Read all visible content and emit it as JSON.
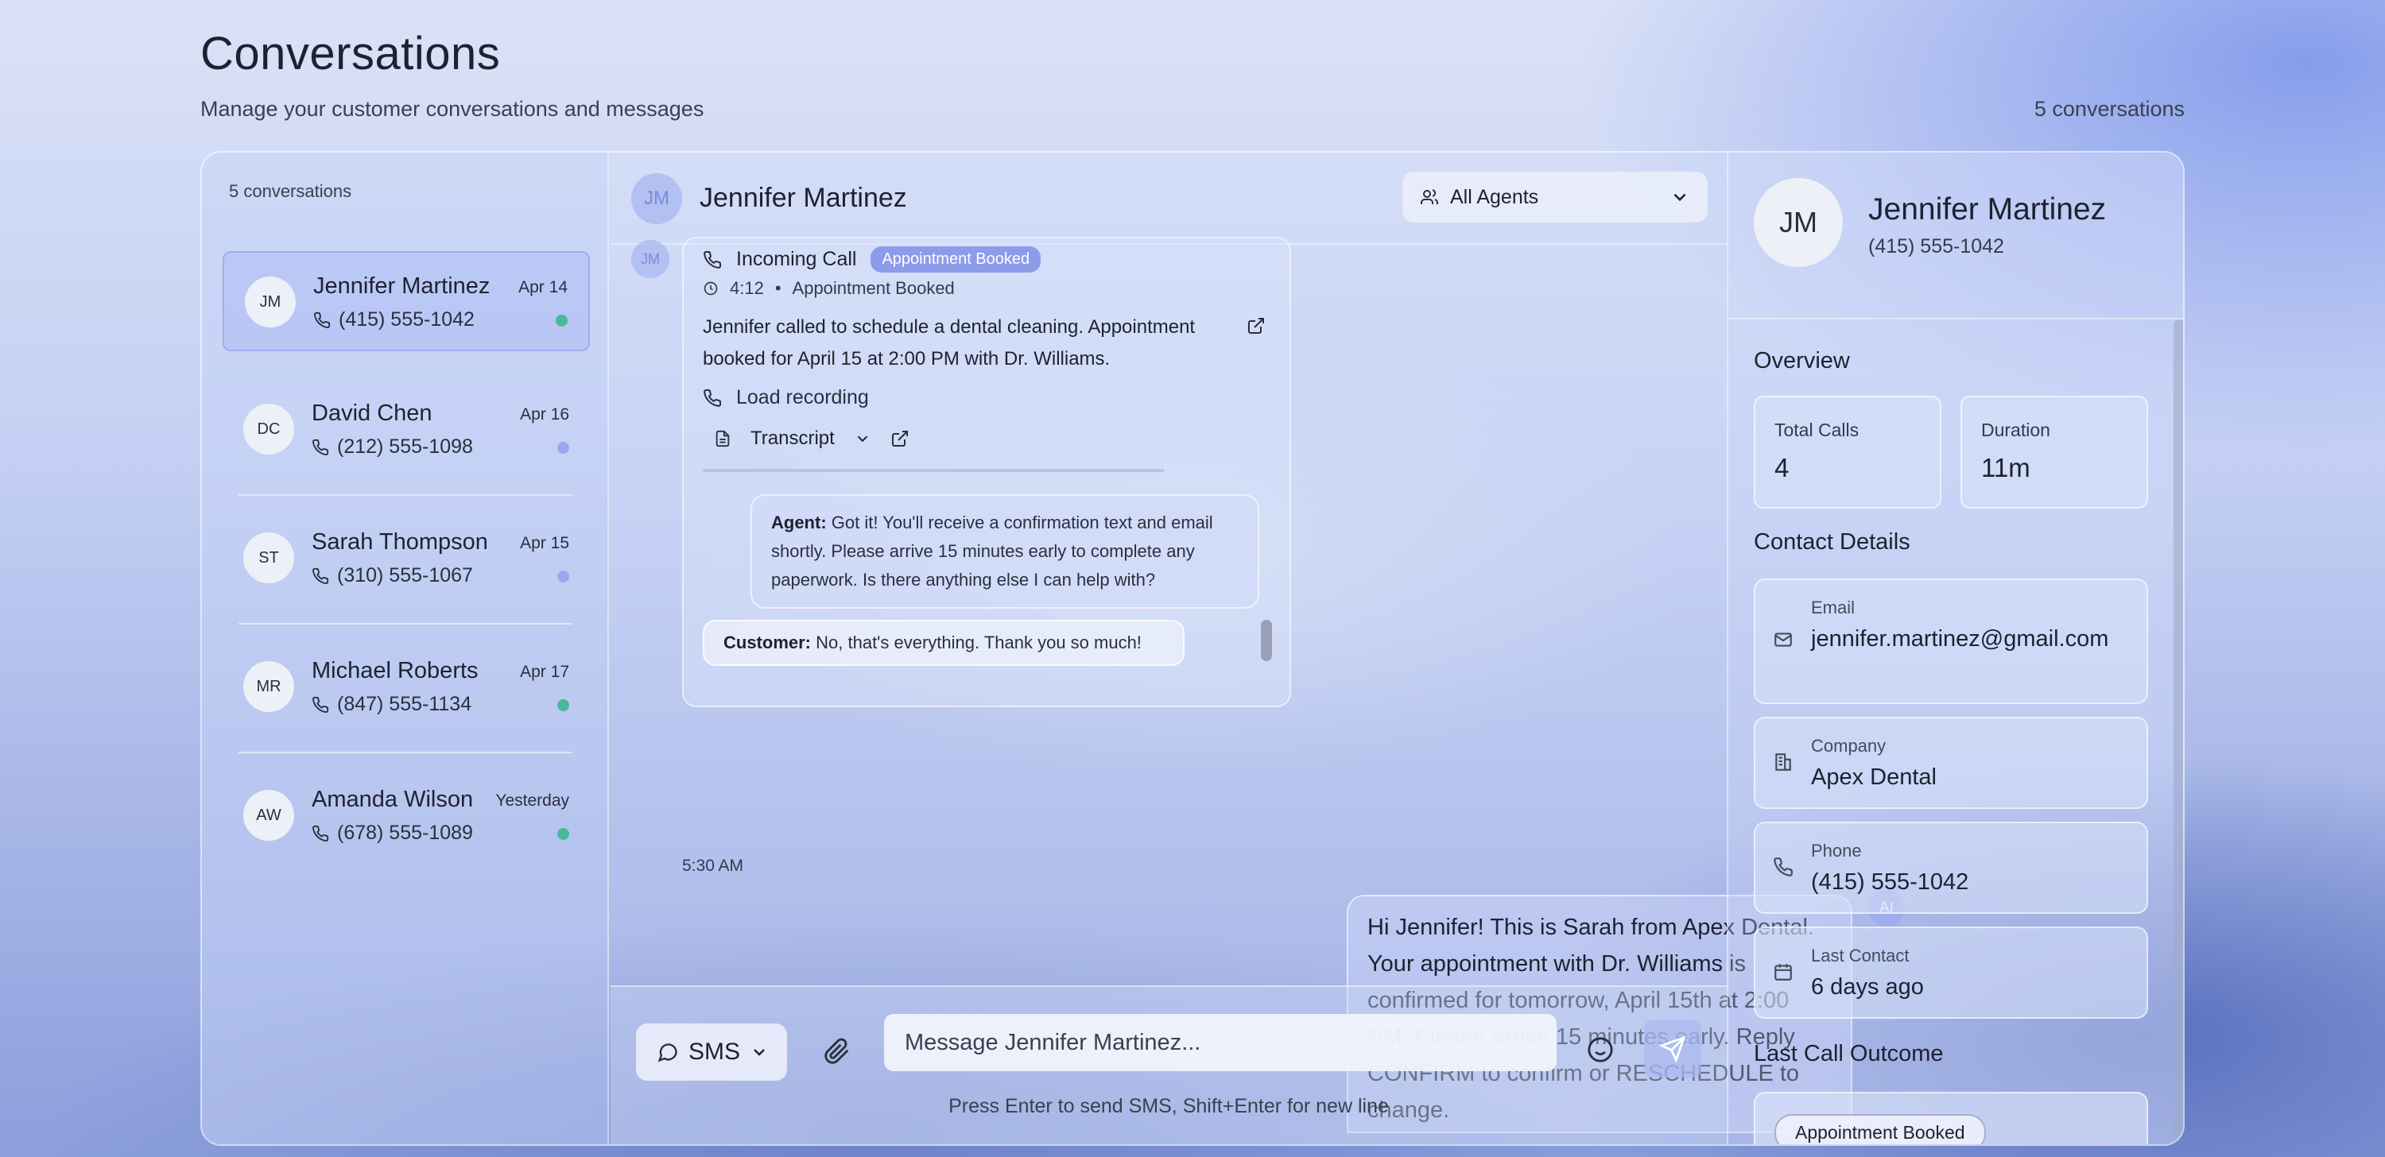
{
  "page": {
    "title": "Conversations",
    "subtitle": "Manage your customer conversations and messages",
    "count_label": "5 conversations"
  },
  "sidebar": {
    "count_label": "5 conversations",
    "conversations": [
      {
        "initials": "JM",
        "name": "Jennifer Martinez",
        "phone": "(415) 555-1042",
        "date": "Apr 14",
        "status_color": "#4bb89a"
      },
      {
        "initials": "DC",
        "name": "David Chen",
        "phone": "(212) 555-1098",
        "date": "Apr 16",
        "status_color": "#9aa8f0"
      },
      {
        "initials": "ST",
        "name": "Sarah Thompson",
        "phone": "(310) 555-1067",
        "date": "Apr 15",
        "status_color": "#9aa8f0"
      },
      {
        "initials": "MR",
        "name": "Michael Roberts",
        "phone": "(847) 555-1134",
        "date": "Apr 17",
        "status_color": "#4bb89a"
      },
      {
        "initials": "AW",
        "name": "Amanda Wilson",
        "phone": "(678) 555-1089",
        "date": "Yesterday",
        "status_color": "#4bb89a"
      }
    ]
  },
  "chat": {
    "header": {
      "initials": "JM",
      "name": "Jennifer Martinez",
      "agent_filter": "All Agents"
    },
    "call_card": {
      "avatar_initials": "JM",
      "title": "Incoming Call",
      "tag": "Appointment Booked",
      "duration": "4:12",
      "outcome": "Appointment Booked",
      "summary": "Jennifer called to schedule a dental cleaning. Appointment booked for April 15 at 2:00 PM with Dr. Williams.",
      "recording_label": "Load recording",
      "transcript_label": "Transcript",
      "agent_label": "Agent:",
      "agent_text": "Got it! You'll receive a confirmation text and email shortly. Please arrive 15 minutes early to complete any paperwork. Is there anything else I can help with?",
      "customer_label": "Customer:",
      "customer_text": "No, that's everything. Thank you so much!"
    },
    "call_time": "5:30 AM",
    "ai_message": "Hi Jennifer! This is Sarah from Apex Dental. Your appointment with Dr. Williams is confirmed for tomorrow, April 15th at 2:00 PM. Please arrive 15 minutes early. Reply CONFIRM to confirm or RESCHEDULE to change.",
    "ai_badge": "AI"
  },
  "composer": {
    "channel": "SMS",
    "placeholder": "Message Jennifer Martinez...",
    "hint": "Press Enter to send SMS, Shift+Enter for new line"
  },
  "contact": {
    "initials": "JM",
    "name": "Jennifer Martinez",
    "phone": "(415) 555-1042",
    "overview_title": "Overview",
    "stats": [
      {
        "label": "Total Calls",
        "value": "4"
      },
      {
        "label": "Duration",
        "value": "11m"
      }
    ],
    "details_title": "Contact Details",
    "details": [
      {
        "label": "Email",
        "value": "jennifer.martinez@gmail.com",
        "icon": "mail-icon"
      },
      {
        "label": "Company",
        "value": "Apex Dental",
        "icon": "building-icon"
      },
      {
        "label": "Phone",
        "value": "(415) 555-1042",
        "icon": "phone-icon"
      },
      {
        "label": "Last Contact",
        "value": "6 days ago",
        "icon": "calendar-icon"
      }
    ],
    "outcome_title": "Last Call Outcome",
    "outcome": "Appointment Booked"
  },
  "colors": {
    "accent": "#8c9bea",
    "online": "#4bb89a",
    "pending": "#9aa8f0"
  }
}
